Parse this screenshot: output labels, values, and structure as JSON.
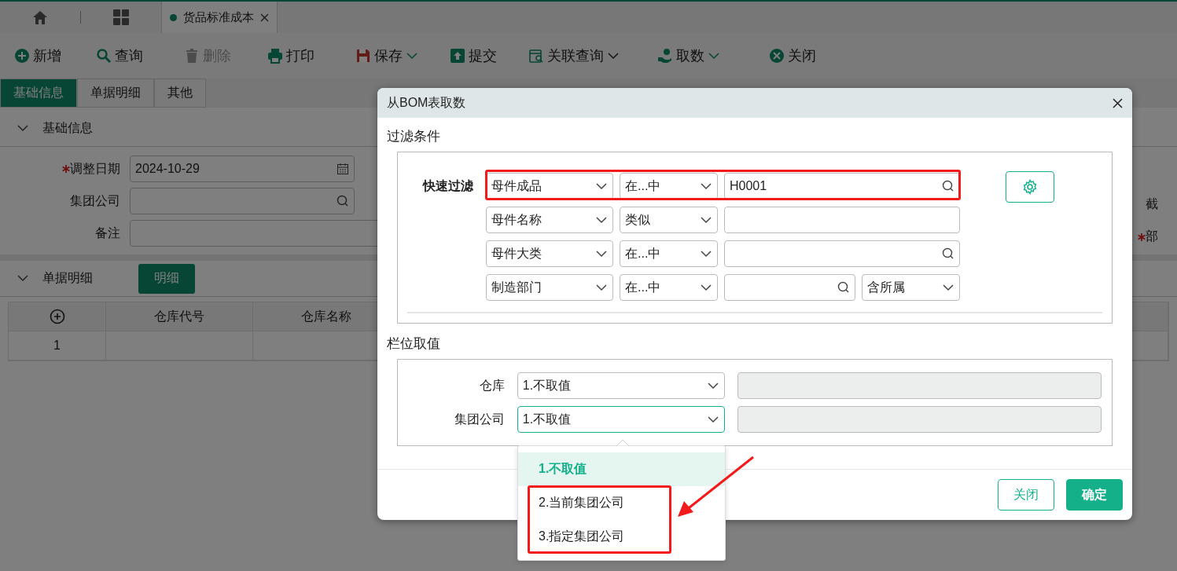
{
  "tab_bar": {
    "tabs": [
      {
        "label": "货品标准成本",
        "selected": true,
        "color": "#074534"
      }
    ]
  },
  "toolbar": [
    {
      "label": "新增",
      "disabled": false,
      "dropdown": false
    },
    {
      "label": "查询",
      "disabled": false,
      "dropdown": false
    },
    {
      "label": "删除",
      "disabled": true,
      "dropdown": false
    },
    {
      "label": "打印",
      "disabled": false,
      "dropdown": false
    },
    {
      "label": "保存",
      "disabled": false,
      "dropdown": true
    },
    {
      "label": "提交",
      "disabled": false,
      "dropdown": false
    },
    {
      "label": "关联查询",
      "disabled": false,
      "dropdown": true
    },
    {
      "label": "取数",
      "disabled": false,
      "dropdown": true
    },
    {
      "label": "关闭",
      "disabled": false,
      "dropdown": false
    }
  ],
  "form_tabs": [
    {
      "label": "基础信息",
      "selected": true
    },
    {
      "label": "单据明细",
      "selected": false
    },
    {
      "label": "其他",
      "selected": false
    }
  ],
  "basic_info": {
    "title": "基础信息",
    "expanded": true,
    "fields": [
      {
        "label": "调整日期",
        "required": true,
        "kind": "date",
        "value": "2024-10-29"
      },
      {
        "label": "集团公司",
        "required": false,
        "kind": "lookup"
      },
      {
        "label": "备注",
        "required": false,
        "kind": "text"
      }
    ],
    "right_fields": [
      {
        "label": "截",
        "required": false
      },
      {
        "label": "部",
        "required": true
      }
    ]
  },
  "detail": {
    "title": "单据明细",
    "expanded": true,
    "button": "明细",
    "columns": [
      "仓库代号",
      "仓库名称"
    ],
    "rows": [
      [
        "1"
      ]
    ]
  },
  "dialog": {
    "title": "从BOM表取数",
    "filter_title": "过滤条件",
    "quick_filter_label": "快速过滤",
    "filter_rows": [
      {
        "field": "母件成品",
        "operator": "在...中",
        "value": "H0001",
        "kind": "lookup",
        "highlighted": true
      },
      {
        "field": "母件名称",
        "operator": "类似",
        "kind": "text",
        "highlighted": false
      },
      {
        "field": "母件大类",
        "operator": "在...中",
        "kind": "lookup",
        "highlighted": false
      },
      {
        "field": "制造部门",
        "operator": "在...中",
        "kind": "scoped",
        "scope": "含所属",
        "highlighted": false
      }
    ],
    "column_title": "栏位取值",
    "column_rows": [
      {
        "label": "仓库",
        "value": "1.不取值",
        "focused": false,
        "expanded": false
      },
      {
        "label": "集团公司",
        "value": "1.不取值",
        "focused": true,
        "expanded": true
      }
    ],
    "options": [
      {
        "label": "1.不取值",
        "selected": true,
        "highlighted": false
      },
      {
        "label": "2.当前集团公司",
        "selected": false,
        "highlighted": true
      },
      {
        "label": "3.指定集团公司",
        "selected": false,
        "highlighted": true
      }
    ],
    "buttons": [
      {
        "label": "关闭",
        "kind": "secondary"
      },
      {
        "label": "确定",
        "kind": "primary"
      }
    ]
  }
}
